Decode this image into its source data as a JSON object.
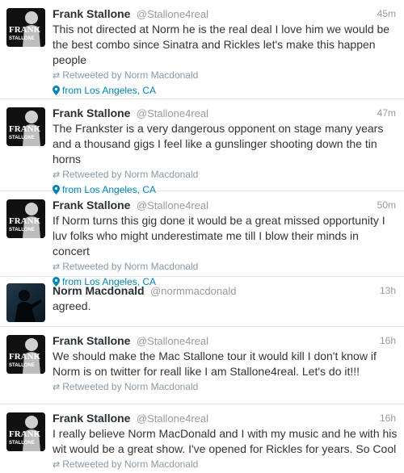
{
  "tweets": [
    {
      "name": "Frank Stallone",
      "handle": "@Stallone4real",
      "time": "45m",
      "avatar": "frank-stallone-avatar",
      "text": "This not directed at Norm he is the real deal I love him we would be the best combo since Sinatra and Rickles let's make this happen people",
      "retweet": "Retweeted by Norm Macdonald",
      "location": "from Los Angeles, CA"
    },
    {
      "name": "Frank Stallone",
      "handle": "@Stallone4real",
      "time": "47m",
      "avatar": "frank-stallone-avatar",
      "text": "The Frankster is a very dangerous opponent on stage many years and a thousand gigs I feel like a gunslinger shooting down the tin horns",
      "retweet": "Retweeted by Norm Macdonald",
      "location": "from Los Angeles, CA"
    },
    {
      "name": "Frank Stallone",
      "handle": "@Stallone4real",
      "time": "50m",
      "avatar": "frank-stallone-avatar",
      "text": "If Norm turns this gig done it would be a great missed opportunity I luv folks who might underestimate me till I blow their minds in concert",
      "retweet": "Retweeted by Norm Macdonald",
      "location": "from Los Angeles, CA"
    },
    {
      "name": "Norm Macdonald",
      "handle": "@normmacdonald",
      "time": "13h",
      "avatar": "norm-macdonald-avatar",
      "text": "agreed."
    },
    {
      "name": "Frank Stallone",
      "handle": "@Stallone4real",
      "time": "16h",
      "avatar": "frank-stallone-avatar",
      "text": "We should make the Mac Stallone tour it would kill I don't know if Norm is on twitter for reall like I am Stallone4real. Let's do it!!!",
      "retweet": "Retweeted by Norm Macdonald"
    },
    {
      "name": "Frank Stallone",
      "handle": "@Stallone4real",
      "time": "16h",
      "avatar": "frank-stallone-avatar",
      "text": "I really believe Norm MacDonald and I with my music and he with his wit would be a great show. I've opened for Rickles for years. So Cool",
      "retweet": "Retweeted by Norm Macdonald"
    }
  ],
  "avatar_logo": {
    "line1": "FRANK",
    "line2": "STALLONE"
  },
  "colors": {
    "link": "#0084b4",
    "meta": "#999999",
    "text": "#333333"
  }
}
